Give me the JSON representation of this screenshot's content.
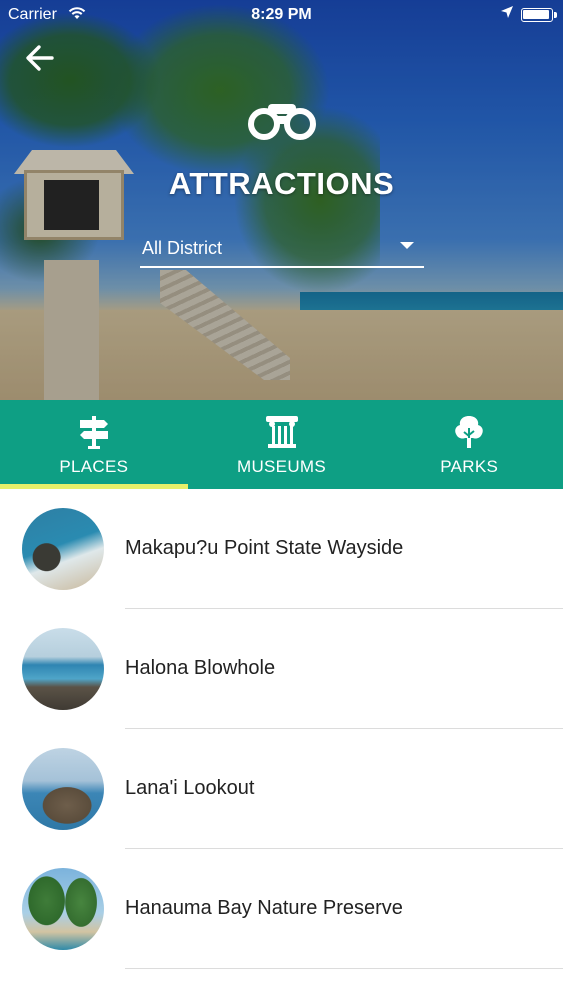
{
  "status_bar": {
    "carrier": "Carrier",
    "time": "8:29 PM",
    "wifi_icon": "wifi-icon",
    "location_icon": "location-arrow-icon",
    "battery_icon": "battery-icon"
  },
  "header": {
    "back_icon": "arrow-left-icon",
    "section_icon": "binoculars-icon",
    "title": "ATTRACTIONS",
    "district_select": {
      "selected": "All District",
      "caret_icon": "caret-down-icon"
    }
  },
  "tabs": [
    {
      "label": "PLACES",
      "icon": "signpost-icon",
      "active": true
    },
    {
      "label": "MUSEUMS",
      "icon": "column-icon",
      "active": false
    },
    {
      "label": "PARKS",
      "icon": "tree-icon",
      "active": false
    }
  ],
  "places": [
    {
      "name": "Makapu?u Point State Wayside"
    },
    {
      "name": "Halona Blowhole"
    },
    {
      "name": "Lana'i Lookout"
    },
    {
      "name": "Hanauma Bay Nature Preserve"
    }
  ],
  "colors": {
    "tab_bar": "#0e9f84",
    "tab_indicator": "#e7f06a",
    "text_primary": "#222222",
    "separator": "#dcdcdc"
  }
}
